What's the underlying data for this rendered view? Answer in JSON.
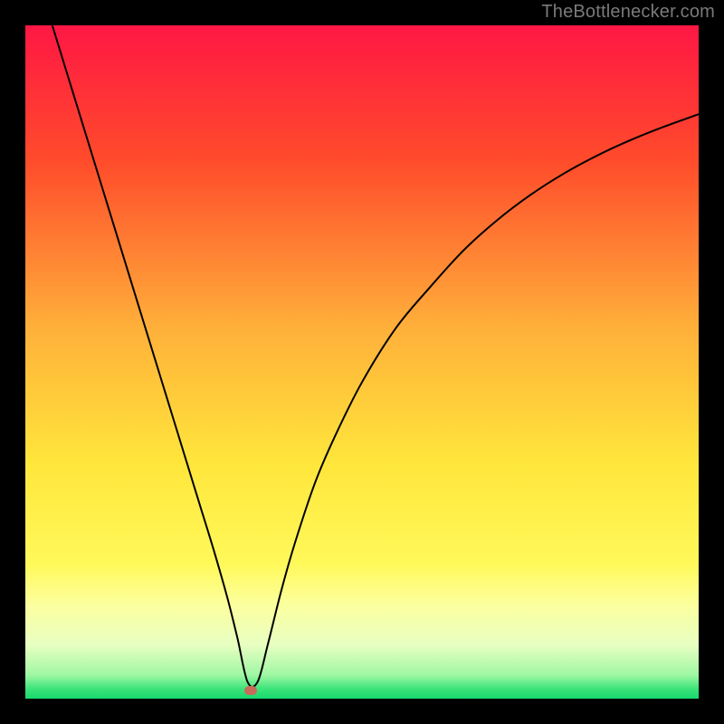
{
  "watermark": {
    "text": "TheBottlenecker.com"
  },
  "marker": {
    "x_pct": 33.5,
    "y_pct": 98.8,
    "color": "#c76b5a"
  },
  "chart_data": {
    "type": "line",
    "title": "",
    "xlabel": "",
    "ylabel": "",
    "xlim": [
      0,
      100
    ],
    "ylim": [
      0,
      100
    ],
    "grid": false,
    "legend": false,
    "background_gradient_stops": [
      {
        "pct": 0,
        "color": "#ff1744"
      },
      {
        "pct": 20,
        "color": "#ff4b2b"
      },
      {
        "pct": 45,
        "color": "#ffb03a"
      },
      {
        "pct": 65,
        "color": "#ffe63b"
      },
      {
        "pct": 80,
        "color": "#fff95a"
      },
      {
        "pct": 86,
        "color": "#fcff9e"
      },
      {
        "pct": 92,
        "color": "#e8ffc2"
      },
      {
        "pct": 96.5,
        "color": "#9ff7a3"
      },
      {
        "pct": 98.5,
        "color": "#3de47a"
      },
      {
        "pct": 100,
        "color": "#17d96d"
      }
    ],
    "series": [
      {
        "name": "bottleneck-curve",
        "color": "#000000",
        "width": 2,
        "x": [
          4,
          6,
          8,
          10,
          12,
          14,
          16,
          18,
          20,
          22,
          24,
          26,
          28,
          30,
          31.5,
          33,
          34.5,
          36,
          38,
          40,
          43,
          46,
          50,
          55,
          60,
          65,
          70,
          75,
          80,
          85,
          90,
          95,
          100
        ],
        "y": [
          100,
          93.5,
          87,
          80.5,
          74,
          67.5,
          61,
          54.5,
          48,
          41.5,
          35,
          28.5,
          22,
          15,
          9,
          2.5,
          2.5,
          8,
          16,
          23,
          32,
          39,
          47,
          55,
          61,
          66.5,
          71,
          74.8,
          78,
          80.7,
          83,
          85,
          86.8
        ]
      }
    ],
    "marker_point": {
      "x": 33.5,
      "y": 1.2,
      "color": "#c76b5a"
    }
  }
}
